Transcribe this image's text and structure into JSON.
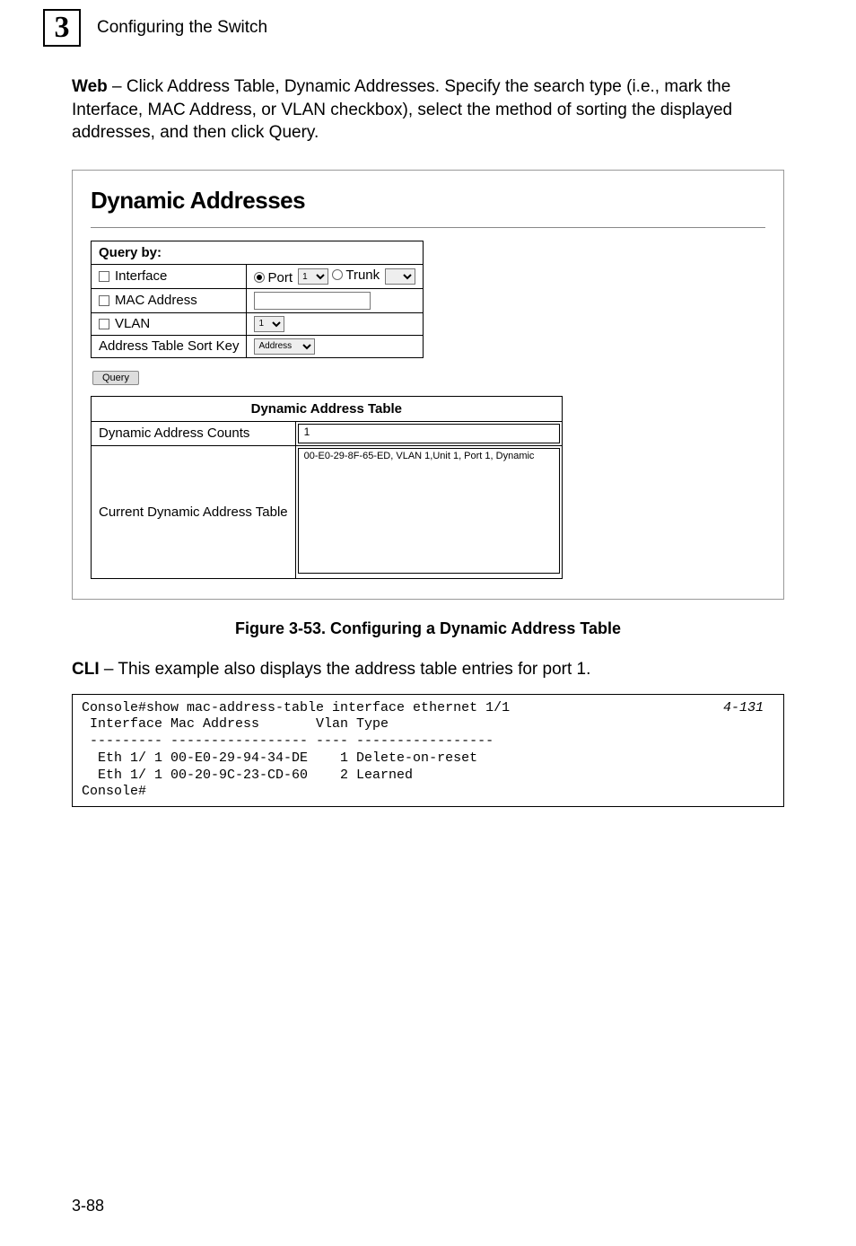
{
  "header": {
    "chapter_number": "3",
    "chapter_title": "Configuring the Switch"
  },
  "intro": {
    "web_label": "Web",
    "web_text": " – Click Address Table, Dynamic Addresses. Specify the search type (i.e., mark the Interface, MAC Address, or VLAN checkbox), select the method of sorting the displayed addresses, and then click Query."
  },
  "panel": {
    "title": "Dynamic Addresses",
    "query_header": "Query by:",
    "rows": {
      "interface_label": "Interface",
      "port_label": "Port",
      "port_option": "1",
      "trunk_label": "Trunk",
      "trunk_option": " ",
      "mac_label": "MAC Address",
      "vlan_label": "VLAN",
      "vlan_option": "1",
      "sort_key_label": "Address Table Sort Key",
      "sort_key_option": "Address"
    },
    "query_btn": "Query",
    "dat_caption": "Dynamic Address Table",
    "count_label": "Dynamic Address Counts",
    "count_value": "1",
    "curr_label": "Current Dynamic Address Table",
    "curr_entry": "00-E0-29-8F-65-ED, VLAN 1,Unit 1, Port 1, Dynamic"
  },
  "figure_caption": "Figure 3-53.  Configuring a Dynamic Address Table",
  "cli": {
    "cli_label": "CLI",
    "cli_text": " – This example also displays the address table entries for port 1.",
    "ref": "4-131",
    "line1": "Console#show mac-address-table interface ethernet 1/1",
    "line2": " Interface Mac Address       Vlan Type",
    "line3": " --------- ----------------- ---- -----------------",
    "line4": "  Eth 1/ 1 00-E0-29-94-34-DE    1 Delete-on-reset",
    "line5": "  Eth 1/ 1 00-20-9C-23-CD-60    2 Learned",
    "line6": "Console#"
  },
  "page_number": "3-88"
}
